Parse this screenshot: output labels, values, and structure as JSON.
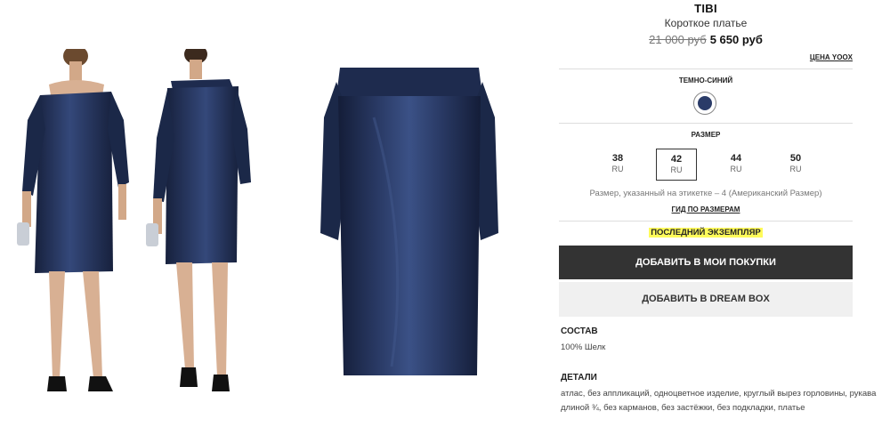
{
  "product": {
    "brand": "TIBI",
    "type": "Короткое платье",
    "old_price": "21 000 руб",
    "new_price": "5 650 руб",
    "yoox_price_link": "ЦЕНА YOOX"
  },
  "color": {
    "label": "ТЕМНО-СИНИЙ",
    "swatch_hex": "#2a3b68"
  },
  "size": {
    "label": "РАЗМЕР",
    "options": [
      {
        "value": "38",
        "system": "RU",
        "selected": false
      },
      {
        "value": "42",
        "system": "RU",
        "selected": true
      },
      {
        "value": "44",
        "system": "RU",
        "selected": false
      },
      {
        "value": "50",
        "system": "RU",
        "selected": false
      }
    ],
    "note": "Размер, указанный на этикетке – 4 (Американский Размер)",
    "guide_link": "ГИД ПО РАЗМЕРАМ"
  },
  "availability": "ПОСЛЕДНИЙ ЭКЗЕМПЛЯР",
  "buttons": {
    "add_to_cart": "ДОБАВИТЬ В МОИ ПОКУПКИ",
    "add_to_dreambox": "ДОБАВИТЬ В DREAM BOX"
  },
  "composition": {
    "title": "СОСТАВ",
    "text": "100% Шелк"
  },
  "details": {
    "title": "ДЕТАЛИ",
    "text": "атлас, без аппликаций, одноцветное изделие, круглый вырез горловины, рукава длиной ¾, без карманов, без застёжки, без подкладки, платье"
  },
  "colors": {
    "dress": "#1f2d52",
    "dress_highlight": "#3a4f80",
    "buy_button": "#333333",
    "highlight": "#fffb5a"
  },
  "images": [
    {
      "name": "model-front-photo"
    },
    {
      "name": "model-side-photo"
    },
    {
      "name": "product-flat-photo"
    }
  ]
}
